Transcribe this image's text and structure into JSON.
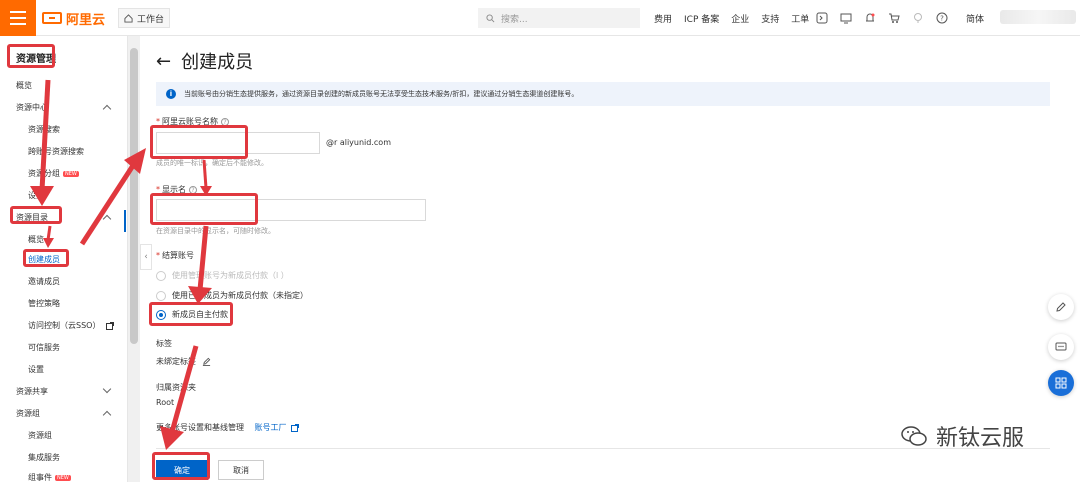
{
  "topbar": {
    "logo_text": "阿里云",
    "workbench_label": "工作台",
    "search_placeholder": "搜索...",
    "nav": [
      "费用",
      "ICP 备案",
      "企业",
      "支持",
      "工单"
    ],
    "icons": [
      "terminal-icon",
      "monitor-icon",
      "bell-icon",
      "cart-icon",
      "bulb-icon",
      "help-icon"
    ],
    "lang": "简体"
  },
  "sidebar": {
    "title": "资源管理",
    "items": [
      {
        "label": "概览",
        "level": 1
      },
      {
        "label": "资源中心",
        "level": 1,
        "expanded": true
      },
      {
        "label": "资源搜索",
        "level": 2
      },
      {
        "label": "跨账号资源搜索",
        "level": 2
      },
      {
        "label": "资源分组",
        "level": 2,
        "badge": "NEW"
      },
      {
        "label": "设置",
        "level": 2
      },
      {
        "label": "资源目录",
        "level": 1,
        "expanded": true
      },
      {
        "label": "概览",
        "level": 2
      },
      {
        "label": "创建成员",
        "level": 2,
        "active": true
      },
      {
        "label": "邀请成员",
        "level": 2
      },
      {
        "label": "管控策略",
        "level": 2
      },
      {
        "label": "访问控制（云SSO）",
        "level": 2,
        "external": true
      },
      {
        "label": "可信服务",
        "level": 2
      },
      {
        "label": "设置",
        "level": 2
      },
      {
        "label": "资源共享",
        "level": 1,
        "expanded": false
      },
      {
        "label": "资源组",
        "level": 1,
        "expanded": true
      },
      {
        "label": "资源组",
        "level": 2
      },
      {
        "label": "集成服务",
        "level": 2
      },
      {
        "label": "组事件",
        "level": 2,
        "badge": "NEW"
      }
    ]
  },
  "main": {
    "title": "创建成员",
    "info_text": "当前账号由分销生态提供服务，通过资源目录创建的新成员账号无法享受生态技术服务/折扣，建议通过分销生态渠道创建账号。",
    "account_name": {
      "label": "阿里云账号名称",
      "value": "",
      "suffix": "@r          aliyunid.com",
      "hint": "成员的唯一标识，确定后不能修改。"
    },
    "display_name": {
      "label": "显示名",
      "value": "",
      "hint": "在资源目录中的显示名，可随时修改。"
    },
    "billing": {
      "label": "结算账号",
      "options": [
        {
          "label": "使用管理账号为新成员付款（l          ）",
          "selected": false,
          "disabled": true
        },
        {
          "label": "使用已有成员为新成员付款（未指定）",
          "selected": false,
          "disabled": false
        },
        {
          "label": "新成员自主付款",
          "selected": true,
          "disabled": false
        }
      ]
    },
    "tags": {
      "label": "标签",
      "value": "未绑定标签"
    },
    "directory": {
      "label": "归属资源夹",
      "value": "Root"
    },
    "more": {
      "label": "更多账号设置和基线管理",
      "link": "账号工厂"
    },
    "confirm_label": "确定",
    "cancel_label": "取消"
  },
  "watermark": "新钛云服",
  "colors": {
    "brand": "#ff6a00",
    "primary": "#0064c8",
    "annotation": "#e0383e"
  }
}
